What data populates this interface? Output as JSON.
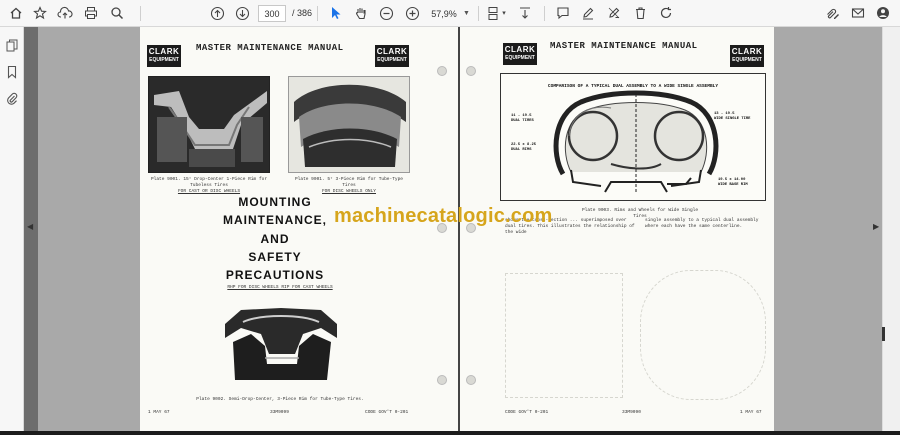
{
  "toolbar": {
    "page_current": "300",
    "page_total": "/ 386",
    "zoom": "57,9%"
  },
  "left_page": {
    "header": "MASTER MAINTENANCE MANUAL",
    "logo_top": "CLARK",
    "logo_bottom": "EQUIPMENT",
    "caption_plate1": "Plate 9001. 15° Drop-Center 1-Piece Rim for Tubeless Tires",
    "caption_plate1_sub": "FOR CAST OR DISC WHEELS",
    "caption_plate2": "Plate 9001. 5° 3-Piece Rim for Tube-Type Tires",
    "caption_plate2_sub": "FOR DISC WHEELS ONLY",
    "title_lines": [
      "MOUNTING",
      "MAINTENANCE,",
      "AND",
      "SAFETY",
      "PRECAUTIONS"
    ],
    "sub_labels": "RHP FOR DISC WHEELS   RIP FOR CAST WHEELS",
    "caption_plate3": "Plate 9002. Semi-Drop-Center, 3-Piece Rim for Tube-Type Tires.",
    "footer_date": "1 MAY 67",
    "footer_num": "33M9099",
    "footer_code": "CODE GOV'T 0-201"
  },
  "right_page": {
    "header": "MASTER MAINTENANCE MANUAL",
    "logo_top": "CLARK",
    "logo_bottom": "EQUIPMENT",
    "diagram_title": "COMPARISON OF A TYPICAL DUAL ASSEMBLY TO A WIDE SINGLE ASSEMBLY",
    "label_dual_tires": "11 - 19.5\nDUAL TIRES",
    "label_wide_tire": "13 - 19.5\nWIDE SINGLE TIRE",
    "label_dual_rims": "22.5 x 8.25\nDUAL RIMS",
    "label_wide_rim": "19.5 x 14.00\nWIDE BASE RIM",
    "caption_plate": "Plate 9003. Rims and Wheels for Wide Single Tires",
    "caption_left": "shows the cross-section ... superimposed over dual tires. This illustrates the relationship of the wide",
    "caption_right": "single assembly to a typical dual assembly where each have the same centerline.",
    "footer_code": "CODE GOV'T 0-201",
    "footer_num": "33M9090",
    "footer_date": "1 MAY 67"
  },
  "watermark": "machinecatalogic.com"
}
